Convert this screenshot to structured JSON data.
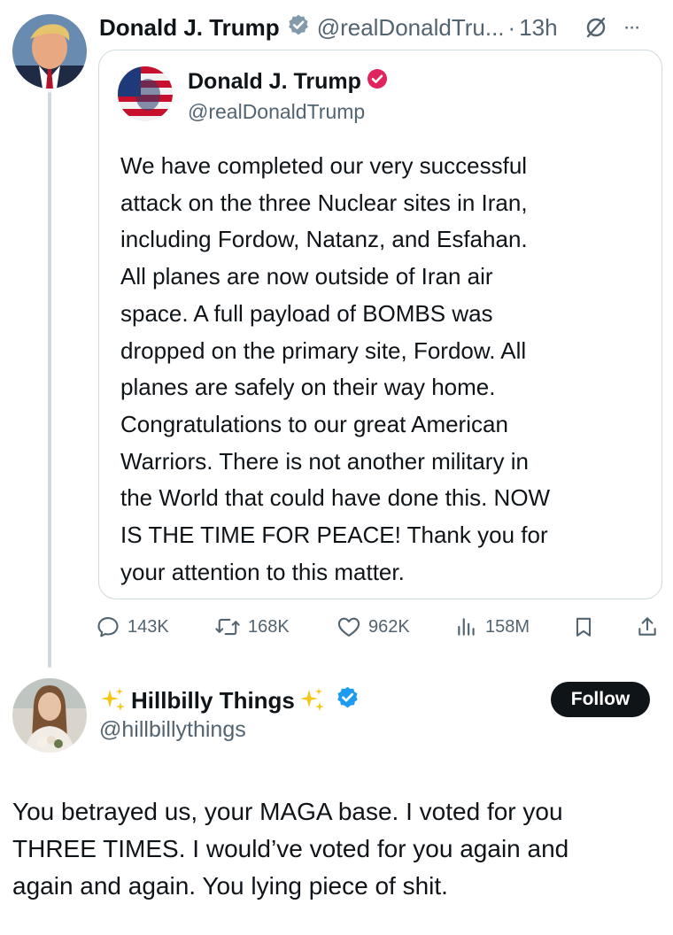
{
  "tweet": {
    "author_name": "Donald J. Trump",
    "author_handle": "@realDonaldTru...",
    "separator": "·",
    "time": "13h",
    "more_label": "···"
  },
  "quote": {
    "author_name": "Donald J. Trump",
    "author_handle": "@realDonaldTrump",
    "badge_color": "#e0245e",
    "body_lines": [
      "We have completed our very successful",
      "attack on the three Nuclear sites in Iran,",
      "including Fordow, Natanz, and Esfahan.",
      "All planes are now outside of Iran air",
      "space. A full payload of BOMBS was",
      "dropped on the primary site, Fordow. All",
      "planes are safely on their way home.",
      "Congratulations to our great American",
      "Warriors. There is not another military in",
      "the World that could have done this. NOW",
      "IS THE TIME FOR PEACE! Thank you for",
      "your attention to this matter."
    ]
  },
  "actions": {
    "replies": "143K",
    "reposts": "168K",
    "likes": "962K",
    "views": "158M"
  },
  "reply": {
    "author_name": "Hillbilly Things",
    "author_handle": "@hillbillythings",
    "follow_label": "Follow",
    "badge_color": "#1d9bf0",
    "body_lines": [
      "You betrayed us, your MAGA base. I voted for you",
      "THREE TIMES. I would’ve voted for you again and",
      "again and again. You lying piece of shit."
    ]
  },
  "colors": {
    "text": "#0f1419",
    "secondary": "#536471",
    "border": "#cfd9de",
    "verified_blue": "#1d9bf0",
    "verified_gray": "#829aab",
    "follow_bg": "#0f1419"
  }
}
